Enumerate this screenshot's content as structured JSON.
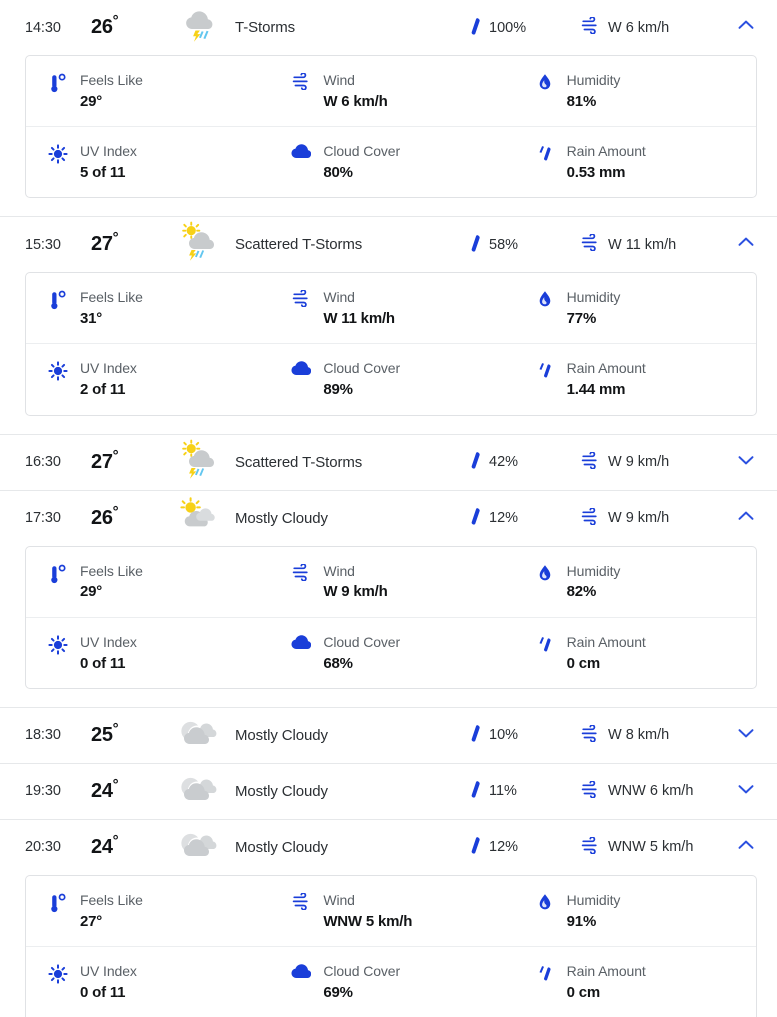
{
  "labels": {
    "feels_like": "Feels Like",
    "wind": "Wind",
    "humidity": "Humidity",
    "uv_index": "UV Index",
    "cloud_cover": "Cloud Cover",
    "rain_amount": "Rain Amount"
  },
  "colors": {
    "accent_blue": "#1a3ed9",
    "link_blue": "#2b50e0",
    "text_primary": "#121416",
    "text_secondary": "#5a6066",
    "divider": "#e6e8ea",
    "card_border": "#e0e2e5",
    "cloud_gray": "#c8cbcd",
    "sun_yellow": "#f7d117",
    "rain_blue": "#62c6ef"
  },
  "icons": {
    "precip": "raindrop-icon",
    "wind": "wind-icon",
    "expand": "chevron-up-icon",
    "collapse": "chevron-down-icon",
    "feels_like": "thermometer-icon",
    "humidity": "water-drop-icon",
    "uv_index": "sun-uv-icon",
    "cloud_cover": "cloud-icon",
    "rain_amount": "raindrop-icon"
  },
  "hours": [
    {
      "time": "14:30",
      "temp": "26",
      "degree": "°",
      "condition": "T-Storms",
      "icon": "thunderstorm-icon",
      "precip": "100%",
      "wind": "W 6 km/h",
      "expanded": true,
      "chevron": "chevron-up-icon",
      "details": {
        "feels_like": "29°",
        "wind": "W 6 km/h",
        "humidity": "81%",
        "uv_index": "5 of 11",
        "cloud_cover": "80%",
        "rain_amount": "0.53 mm"
      }
    },
    {
      "time": "15:30",
      "temp": "27",
      "degree": "°",
      "condition": "Scattered T-Storms",
      "icon": "sun-thunderstorm-icon",
      "precip": "58%",
      "wind": "W 11 km/h",
      "expanded": true,
      "chevron": "chevron-up-icon",
      "details": {
        "feels_like": "31°",
        "wind": "W 11 km/h",
        "humidity": "77%",
        "uv_index": "2 of 11",
        "cloud_cover": "89%",
        "rain_amount": "1.44 mm"
      }
    },
    {
      "time": "16:30",
      "temp": "27",
      "degree": "°",
      "condition": "Scattered T-Storms",
      "icon": "sun-thunderstorm-icon",
      "precip": "42%",
      "wind": "W 9 km/h",
      "expanded": false,
      "chevron": "chevron-down-icon",
      "details": null
    },
    {
      "time": "17:30",
      "temp": "26",
      "degree": "°",
      "condition": "Mostly Cloudy",
      "icon": "sun-cloud-icon",
      "precip": "12%",
      "wind": "W 9 km/h",
      "expanded": true,
      "chevron": "chevron-up-icon",
      "details": {
        "feels_like": "29°",
        "wind": "W 9 km/h",
        "humidity": "82%",
        "uv_index": "0 of 11",
        "cloud_cover": "68%",
        "rain_amount": "0 cm"
      }
    },
    {
      "time": "18:30",
      "temp": "25",
      "degree": "°",
      "condition": "Mostly Cloudy",
      "icon": "moon-cloud-icon",
      "precip": "10%",
      "wind": "W 8 km/h",
      "expanded": false,
      "chevron": "chevron-down-icon",
      "details": null
    },
    {
      "time": "19:30",
      "temp": "24",
      "degree": "°",
      "condition": "Mostly Cloudy",
      "icon": "moon-cloud-icon",
      "precip": "11%",
      "wind": "WNW 6 km/h",
      "expanded": false,
      "chevron": "chevron-down-icon",
      "details": null
    },
    {
      "time": "20:30",
      "temp": "24",
      "degree": "°",
      "condition": "Mostly Cloudy",
      "icon": "moon-cloud-icon",
      "precip": "12%",
      "wind": "WNW 5 km/h",
      "expanded": true,
      "chevron": "chevron-up-icon",
      "details": {
        "feels_like": "27°",
        "wind": "WNW 5 km/h",
        "humidity": "91%",
        "uv_index": "0 of 11",
        "cloud_cover": "69%",
        "rain_amount": "0 cm"
      }
    }
  ]
}
